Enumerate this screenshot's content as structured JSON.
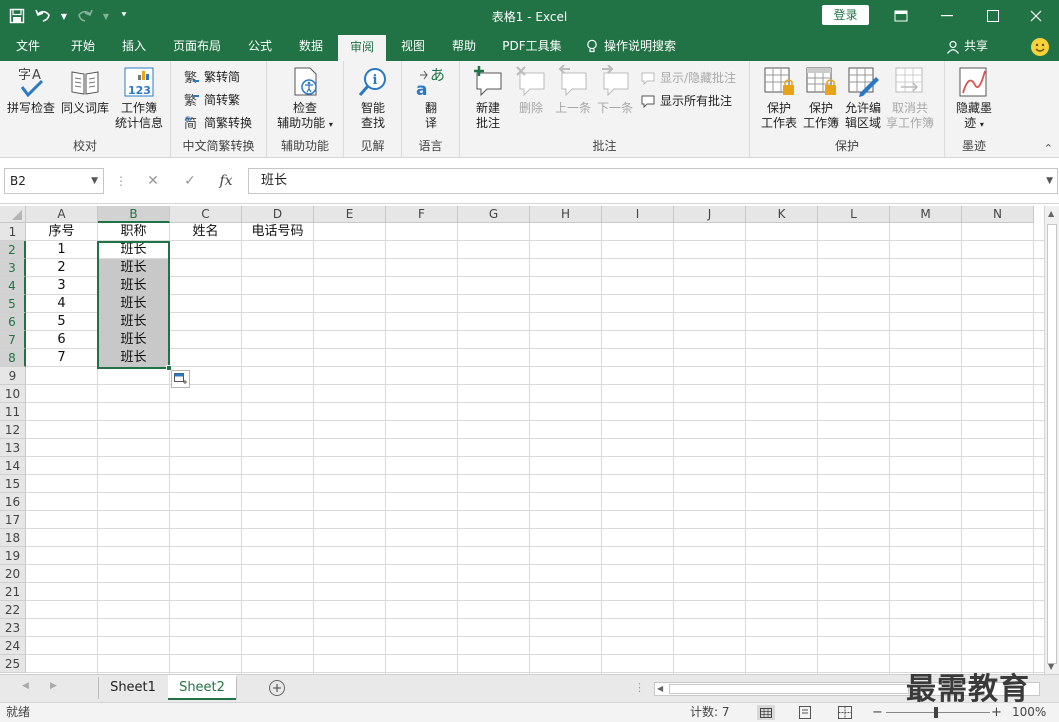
{
  "window": {
    "title": "表格1 - Excel",
    "login_label": "登录"
  },
  "tabs": [
    {
      "label": "文件"
    },
    {
      "label": "开始"
    },
    {
      "label": "插入"
    },
    {
      "label": "页面布局"
    },
    {
      "label": "公式"
    },
    {
      "label": "数据"
    },
    {
      "label": "审阅"
    },
    {
      "label": "视图"
    },
    {
      "label": "帮助"
    },
    {
      "label": "PDF工具集"
    },
    {
      "label": "操作说明搜索"
    }
  ],
  "share_label": "共享",
  "ribbon": {
    "proofing": {
      "label": "校对",
      "spell": "拼写检查",
      "thesaurus": "同义词库",
      "stats_1": "工作簿",
      "stats_2": "统计信息"
    },
    "chinese": {
      "label": "中文简繁转换",
      "to_simplified": "繁转简",
      "to_traditional": "简转繁",
      "convert": "简繁转换"
    },
    "accessibility": {
      "label": "辅助功能",
      "check_1": "检查",
      "check_2": "辅助功能"
    },
    "insights": {
      "label": "见解",
      "smart_1": "智能",
      "smart_2": "查找"
    },
    "language": {
      "label": "语言",
      "translate_1": "翻",
      "translate_2": "译"
    },
    "comments": {
      "label": "批注",
      "new_1": "新建",
      "new_2": "批注",
      "delete": "删除",
      "prev": "上一条",
      "next": "下一条",
      "show_hide": "显示/隐藏批注",
      "show_all": "显示所有批注"
    },
    "protect": {
      "label": "保护",
      "sheet_1": "保护",
      "sheet_2": "工作表",
      "book_1": "保护",
      "book_2": "工作簿",
      "ranges_1": "允许编",
      "ranges_2": "辑区域",
      "unshare_1": "取消共",
      "unshare_2": "享工作簿"
    },
    "ink": {
      "label": "墨迹",
      "hide_1": "隐藏墨",
      "hide_2": "迹"
    }
  },
  "formula_bar": {
    "name_box": "B2",
    "content": "班长"
  },
  "columns": [
    "A",
    "B",
    "C",
    "D",
    "E",
    "F",
    "G",
    "H",
    "I",
    "J",
    "K",
    "L",
    "M",
    "N"
  ],
  "rows": [
    "1",
    "2",
    "3",
    "4",
    "5",
    "6",
    "7",
    "8",
    "9",
    "10",
    "11",
    "12",
    "13",
    "14",
    "15",
    "16",
    "17",
    "18",
    "19",
    "20",
    "21",
    "22",
    "23",
    "24",
    "25"
  ],
  "cells": {
    "A1": "序号",
    "B1": "职称",
    "C1": "姓名",
    "D1": "电话号码",
    "A2": "1",
    "A3": "2",
    "A4": "3",
    "A5": "4",
    "A6": "5",
    "A7": "6",
    "A8": "7",
    "B2": "班长",
    "B3": "班长",
    "B4": "班长",
    "B5": "班长",
    "B6": "班长",
    "B7": "班长",
    "B8": "班长"
  },
  "sheets": [
    {
      "label": "Sheet1"
    },
    {
      "label": "Sheet2"
    }
  ],
  "status": {
    "ready": "就绪",
    "count": "计数: 7",
    "zoom": "100%"
  },
  "watermark": "最需教育",
  "colors": {
    "accent": "#217346",
    "selection_fill": "#c8c8c8"
  }
}
